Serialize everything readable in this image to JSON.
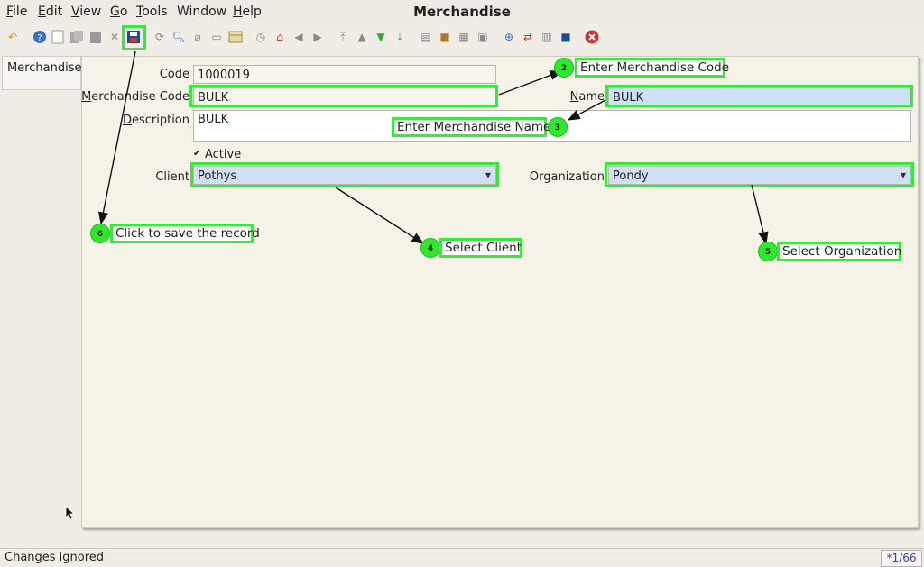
{
  "window": {
    "title": "Merchandise"
  },
  "menu": [
    {
      "label": "File",
      "mnemonic": "F",
      "rest": "ile"
    },
    {
      "label": "Edit",
      "mnemonic": "E",
      "rest": "dit"
    },
    {
      "label": "View",
      "mnemonic": "V",
      "rest": "iew"
    },
    {
      "label": "Go",
      "mnemonic": "G",
      "rest": "o"
    },
    {
      "label": "Tools",
      "mnemonic": "T",
      "rest": "ools"
    },
    {
      "label": "Window",
      "mnemonic": "",
      "rest": "Window"
    },
    {
      "label": "Help",
      "mnemonic": "H",
      "rest": "elp"
    }
  ],
  "toolbar_icons": [
    "undo-icon",
    "help-icon",
    "new-icon",
    "copy-icon",
    "delete-icon",
    "delete-multi-icon",
    "save-icon",
    "refresh-icon",
    "find-icon",
    "attachment-icon",
    "chat-icon",
    "grid-toggle-icon",
    "history-icon",
    "home-icon",
    "previous-icon",
    "next-icon",
    "first-record-icon",
    "previous-record-icon",
    "next-record-icon",
    "last-record-icon",
    "report-icon",
    "archive-icon",
    "print-preview-icon",
    "print-icon",
    "zoom-across-icon",
    "workflow-icon",
    "product-info-icon",
    "end-icon",
    "close-icon"
  ],
  "tab": {
    "label": "Merchandise"
  },
  "form": {
    "code_label": "Code",
    "code_value": "1000019",
    "merchandise_code_label": "Merchandise Code",
    "merchandise_code_mnemonic": "M",
    "merchandise_code_rest": "erchandise Code",
    "merchandise_code_value": "BULK",
    "name_label": "Name",
    "name_mnemonic": "N",
    "name_rest": "ame",
    "name_value": "BULK",
    "description_label": "Description",
    "description_mnemonic": "D",
    "description_rest": "escription",
    "description_value": "BULK",
    "active_label": "Active",
    "active_checked": true,
    "client_label": "Client",
    "client_value": "Pothys",
    "organization_label": "Organization",
    "organization_value": "Pondy"
  },
  "callouts": [
    {
      "number": "2",
      "text": "Enter Merchandise Code"
    },
    {
      "number": "3",
      "text": "Enter Merchandise Name"
    },
    {
      "number": "4",
      "text": "Select Client"
    },
    {
      "number": "5",
      "text": "Select Organization"
    },
    {
      "number": "6",
      "text": "Click to save the record"
    }
  ],
  "status": {
    "message": "Changes ignored",
    "record_count": "*1/66"
  },
  "colors": {
    "highlight": "#38e83a",
    "badge": "#2ee82e",
    "field_blue": "#cfe0f5",
    "panel": "#f5f2e8"
  }
}
